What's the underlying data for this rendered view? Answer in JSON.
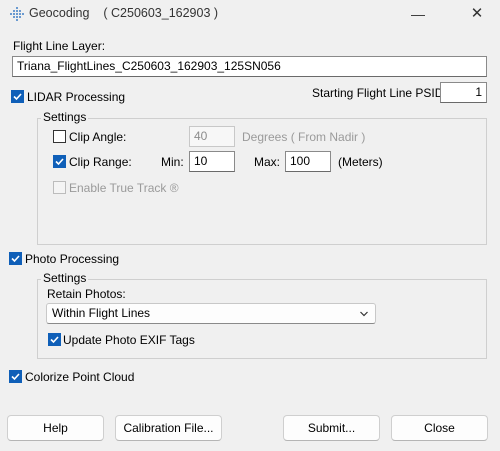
{
  "window": {
    "title": "Geocoding",
    "subtitle": "( C250603_162903 )",
    "minimize_glyph": "—",
    "close_glyph": "✕",
    "icon": "diamond-grid-icon"
  },
  "flight_line_layer": {
    "label": "Flight Line Layer:",
    "value": "Triana_FlightLines_C250603_162903_125SN056"
  },
  "lidar": {
    "label": "LIDAR Processing",
    "checked": true,
    "psid_label": "Starting Flight Line PSID:",
    "psid_value": "1",
    "settings": {
      "title": "Settings",
      "clip_angle": {
        "label": "Clip Angle:",
        "checked": false,
        "value": "40",
        "unit": "Degrees ( From Nadir )"
      },
      "clip_range": {
        "label": "Clip Range:",
        "checked": true,
        "min_label": "Min:",
        "min_value": "10",
        "max_label": "Max:",
        "max_value": "100",
        "unit": "(Meters)"
      },
      "true_track": {
        "label": "Enable True Track ®",
        "checked": false,
        "enabled": false
      }
    }
  },
  "photo": {
    "label": "Photo Processing",
    "checked": true,
    "settings": {
      "title": "Settings",
      "retain_label": "Retain Photos:",
      "retain_value": "Within Flight Lines",
      "exif_label": "Update Photo EXIF Tags",
      "exif_checked": true
    }
  },
  "colorize": {
    "label": "Colorize Point Cloud",
    "checked": true
  },
  "buttons": {
    "help": "Help",
    "calibration": "Calibration File...",
    "submit": "Submit...",
    "close": "Close"
  },
  "colors": {
    "accent": "#0f5fb8",
    "background": "#f0f0f0"
  }
}
